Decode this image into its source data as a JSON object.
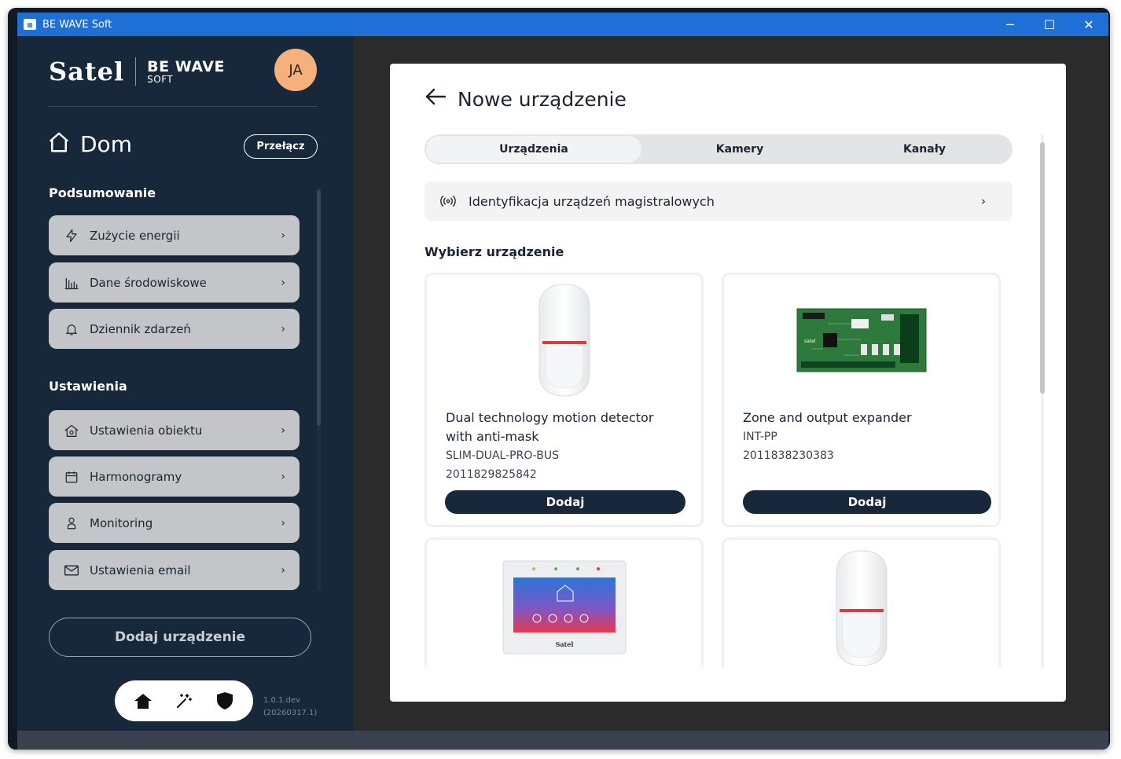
{
  "window": {
    "title": "BE WAVE Soft",
    "minimize": "─",
    "maximize": "☐",
    "close": "✕"
  },
  "brand": {
    "logo": "Satel",
    "product_line1": "BE WAVE",
    "product_line2": "SOFT"
  },
  "user": {
    "initials": "JA"
  },
  "home": {
    "title": "Dom",
    "switch_label": "Przełącz"
  },
  "summary": {
    "title": "Podsumowanie",
    "items": [
      {
        "label": "Zużycie energii",
        "icon": "bolt-icon"
      },
      {
        "label": "Dane środowiskowe",
        "icon": "bar-chart-icon"
      },
      {
        "label": "Dziennik zdarzeń",
        "icon": "bell-icon"
      }
    ]
  },
  "settings": {
    "title": "Ustawienia",
    "items": [
      {
        "label": "Ustawienia obiektu",
        "icon": "house-settings-icon"
      },
      {
        "label": "Harmonogramy",
        "icon": "calendar-icon"
      },
      {
        "label": "Monitoring",
        "icon": "person-icon"
      },
      {
        "label": "Ustawienia email",
        "icon": "mail-icon"
      }
    ]
  },
  "add_device_label": "Dodaj urządzenie",
  "version": {
    "line1": "1.0.1.dev",
    "line2": "(20260317.1)"
  },
  "panel": {
    "title": "Nowe urządzenie",
    "tabs": [
      "Urządzenia",
      "Kamery",
      "Kanały"
    ],
    "active_tab": 0,
    "bus_identification": "Identyfikacja urządzeń magistralowych",
    "pick_title": "Wybierz urządzenie",
    "devices": [
      {
        "name": "Dual technology motion detector with anti-mask",
        "model": "SLIM-DUAL-PRO-BUS",
        "serial": "2011829825842",
        "button": "Dodaj"
      },
      {
        "name": "Zone and output expander",
        "model": "INT-PP",
        "serial": "2011838230383",
        "button": "Dodaj"
      }
    ]
  },
  "colors": {
    "accent_blue": "#1e6fd6",
    "sidebar": "#17283a",
    "avatar": "#f6b07c",
    "menu_item": "#c3c5c8"
  }
}
